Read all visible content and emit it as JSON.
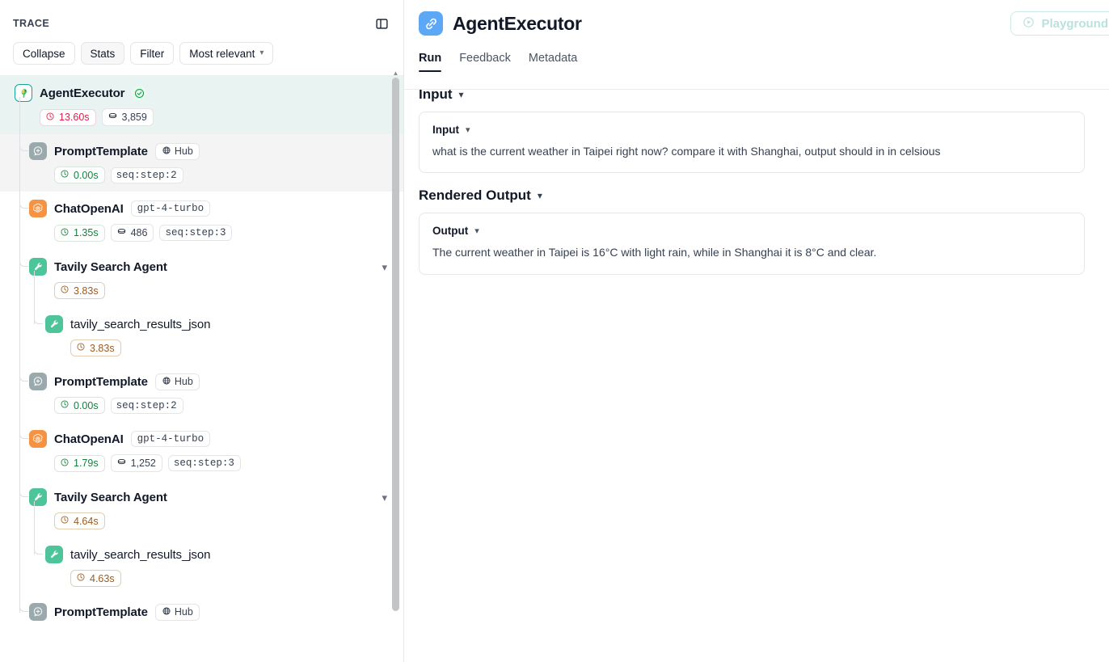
{
  "sidebar": {
    "title": "TRACE",
    "panel_toggle_icon": "panel-toggle-icon",
    "toolbar": {
      "collapse": "Collapse",
      "stats": "Stats",
      "filter": "Filter",
      "sort": "Most relevant"
    },
    "nodes": [
      {
        "label": "AgentExecutor",
        "icon": "langchain-parrot-icon",
        "state": "selected",
        "status": "success",
        "indent": 0,
        "pills": [
          {
            "kind": "latency",
            "icon": "clock-icon",
            "text": "13.60s",
            "tone": "red"
          },
          {
            "kind": "tokens",
            "icon": "token-icon",
            "text": "3,859",
            "tone": "plain"
          }
        ]
      },
      {
        "label": "PromptTemplate",
        "icon": "prompt-template-icon",
        "state": "hovered",
        "indent": 1,
        "tags": [
          {
            "icon": "globe-icon",
            "text": "Hub"
          }
        ],
        "pills": [
          {
            "kind": "latency",
            "icon": "clock-icon",
            "text": "0.00s",
            "tone": "green"
          },
          {
            "kind": "step",
            "text": "seq:step:2",
            "tone": "plain"
          }
        ]
      },
      {
        "label": "ChatOpenAI",
        "icon": "openai-icon",
        "state": "normal",
        "indent": 1,
        "tags": [
          {
            "text": "gpt-4-turbo"
          }
        ],
        "pills": [
          {
            "kind": "latency",
            "icon": "clock-icon",
            "text": "1.35s",
            "tone": "green"
          },
          {
            "kind": "tokens",
            "icon": "token-icon",
            "text": "486",
            "tone": "plain"
          },
          {
            "kind": "step",
            "text": "seq:step:3",
            "tone": "plain"
          }
        ]
      },
      {
        "label": "Tavily Search Agent",
        "icon": "wrench-icon",
        "state": "normal",
        "indent": 1,
        "expander": "chevron-down-icon",
        "pills": [
          {
            "kind": "latency",
            "icon": "clock-icon",
            "text": "3.83s",
            "tone": "amber"
          }
        ]
      },
      {
        "label": "tavily_search_results_json",
        "icon": "wrench-icon",
        "state": "normal",
        "indent": 2,
        "pills": [
          {
            "kind": "latency",
            "icon": "clock-icon",
            "text": "3.83s",
            "tone": "amber"
          }
        ]
      },
      {
        "label": "PromptTemplate",
        "icon": "prompt-template-icon",
        "state": "normal",
        "indent": 1,
        "tags": [
          {
            "icon": "globe-icon",
            "text": "Hub"
          }
        ],
        "pills": [
          {
            "kind": "latency",
            "icon": "clock-icon",
            "text": "0.00s",
            "tone": "green"
          },
          {
            "kind": "step",
            "text": "seq:step:2",
            "tone": "plain"
          }
        ]
      },
      {
        "label": "ChatOpenAI",
        "icon": "openai-icon",
        "state": "normal",
        "indent": 1,
        "tags": [
          {
            "text": "gpt-4-turbo"
          }
        ],
        "pills": [
          {
            "kind": "latency",
            "icon": "clock-icon",
            "text": "1.79s",
            "tone": "green"
          },
          {
            "kind": "tokens",
            "icon": "token-icon",
            "text": "1,252",
            "tone": "plain"
          },
          {
            "kind": "step",
            "text": "seq:step:3",
            "tone": "plain"
          }
        ]
      },
      {
        "label": "Tavily Search Agent",
        "icon": "wrench-icon",
        "state": "normal",
        "indent": 1,
        "expander": "chevron-down-icon",
        "pills": [
          {
            "kind": "latency",
            "icon": "clock-icon",
            "text": "4.64s",
            "tone": "amber"
          }
        ]
      },
      {
        "label": "tavily_search_results_json",
        "icon": "wrench-icon",
        "state": "normal",
        "indent": 2,
        "pills": [
          {
            "kind": "latency",
            "icon": "clock-icon",
            "text": "4.63s",
            "tone": "amber"
          }
        ]
      },
      {
        "label": "PromptTemplate",
        "icon": "prompt-template-icon",
        "state": "normal",
        "indent": 1,
        "tags": [
          {
            "icon": "globe-icon",
            "text": "Hub"
          }
        ],
        "pills": []
      }
    ]
  },
  "main": {
    "title": "AgentExecutor",
    "title_icon": "chain-link-icon",
    "playground_label": "Playground",
    "playground_icon": "play-circle-icon",
    "tabs": [
      {
        "label": "Run",
        "active": true
      },
      {
        "label": "Feedback",
        "active": false
      },
      {
        "label": "Metadata",
        "active": false
      }
    ],
    "sections": [
      {
        "heading": "Input",
        "card_label": "Input",
        "body": "what is the current weather in Taipei right now? compare it with Shanghai, output should in in celsious"
      },
      {
        "heading": "Rendered Output",
        "card_label": "Output",
        "body": "The current weather in Taipei is 16°C with light rain, while in Shanghai it is 8°C and clear."
      }
    ]
  },
  "colors": {
    "selected_row": "#e9f3f2",
    "hover_row": "#f4f4f5",
    "accent_blue": "#5ca8f7",
    "tool_green": "#4ec49a",
    "openai_orange": "#f59342",
    "latency_red": "#e11d48",
    "latency_amber": "#9a5b20",
    "latency_green": "#15803d"
  }
}
